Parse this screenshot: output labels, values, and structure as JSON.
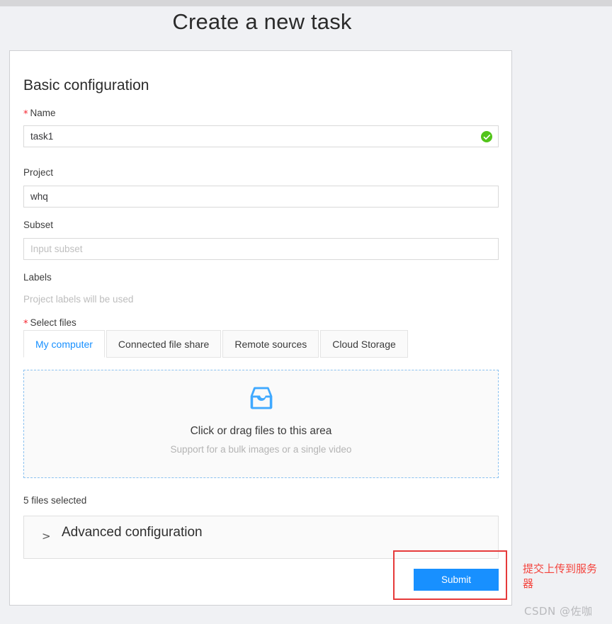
{
  "page": {
    "title": "Create a new task"
  },
  "card": {
    "section_title": "Basic configuration",
    "fields": {
      "name": {
        "label": "Name",
        "required_marker": "*",
        "value": "task1",
        "placeholder": "",
        "validation_icon": "check-circle-icon",
        "validation_color": "#52c41a"
      },
      "project": {
        "label": "Project",
        "value": "whq",
        "placeholder": ""
      },
      "subset": {
        "label": "Subset",
        "value": "",
        "placeholder": "Input subset"
      },
      "labels": {
        "label": "Labels",
        "hint": "Project labels will be used"
      },
      "select_files": {
        "label": "Select files",
        "required_marker": "*"
      }
    },
    "tabs": [
      {
        "label": "My computer",
        "active": true
      },
      {
        "label": "Connected file share",
        "active": false
      },
      {
        "label": "Remote sources",
        "active": false
      },
      {
        "label": "Cloud Storage",
        "active": false
      }
    ],
    "dropzone": {
      "icon": "inbox-icon",
      "icon_color": "#40a9ff",
      "main_text": "Click or drag files to this area",
      "sub_text": "Support for a bulk images or a single video",
      "border_color": "#8cc2f0"
    },
    "files_selected": "5 files selected",
    "advanced": {
      "arrow_icon": "chevron-right-icon",
      "label": "Advanced configuration",
      "expanded": false
    },
    "submit": {
      "label": "Submit",
      "color": "#1890ff"
    }
  },
  "annotation": {
    "highlight_color": "#e63a3a",
    "note_text": "提交上传到服务器",
    "note_color": "#f4433c",
    "watermark": "CSDN @佐咖"
  }
}
